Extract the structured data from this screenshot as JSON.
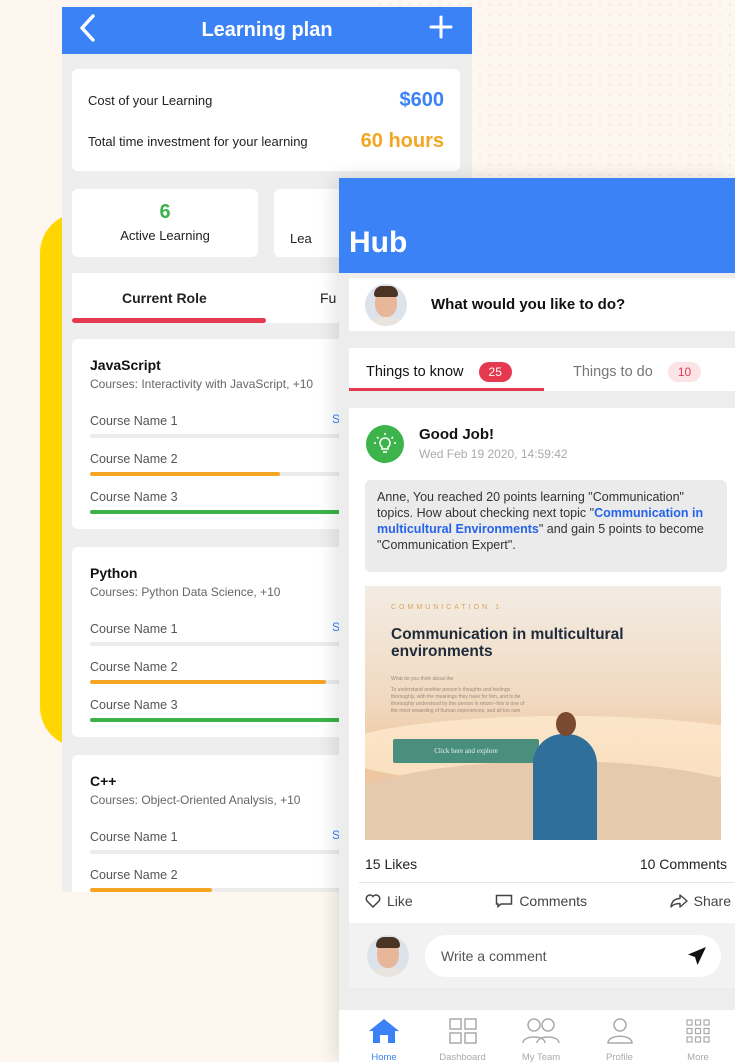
{
  "learning_plan": {
    "title": "Learning plan",
    "back_icon": "chevron-left-icon",
    "add_icon": "plus-icon",
    "cost_label": "Cost of your Learning",
    "cost_value": "$600",
    "time_label": "Total time investment for your learning",
    "time_value": "60 hours",
    "stats": [
      {
        "value": "6",
        "label": "Active Learning"
      },
      {
        "value": "",
        "label": "Lea"
      }
    ],
    "tabs": [
      {
        "label": "Current Role",
        "active": true
      },
      {
        "label": "Fu",
        "active": false
      }
    ],
    "courses": [
      {
        "name": "JavaScript",
        "subtitle": "Courses: Interactivity with JavaScript, +10",
        "rows": [
          {
            "label": "Course Name 1",
            "status": "S",
            "progress": 0,
            "color": "#e0e0e0"
          },
          {
            "label": "Course Name 2",
            "status": "",
            "progress": 0.5,
            "color": "#f4a623"
          },
          {
            "label": "Course Name 3",
            "status": "",
            "progress": 1.0,
            "color": "#3cb44b"
          }
        ]
      },
      {
        "name": "Python",
        "subtitle": "Courses: Python Data Science, +10",
        "rows": [
          {
            "label": "Course Name 1",
            "status": "S",
            "progress": 0,
            "color": "#e0e0e0"
          },
          {
            "label": "Course Name 2",
            "status": "",
            "progress": 0.62,
            "color": "#f4a623"
          },
          {
            "label": "Course Name 3",
            "status": "",
            "progress": 1.0,
            "color": "#3cb44b"
          }
        ]
      },
      {
        "name": "C++",
        "subtitle": "Courses: Object-Oriented Analysis, +10",
        "rows": [
          {
            "label": "Course Name 1",
            "status": "S",
            "progress": 0,
            "color": "#e0e0e0"
          },
          {
            "label": "Course Name 2",
            "status": "",
            "progress": 0.32,
            "color": "#f4a623"
          }
        ]
      }
    ]
  },
  "hub": {
    "title": "Hub",
    "ask_prompt": "What would you like to do?",
    "tabs": [
      {
        "label": "Things to know",
        "count": "25",
        "active": true
      },
      {
        "label": "Things to do",
        "count": "10",
        "active": false
      }
    ],
    "post": {
      "title": "Good Job!",
      "date": "Wed Feb 19 2020, 14:59:42",
      "message_before": "Anne, You reached 20 points learning \"Communication\" topics. How about checking next topic \"",
      "message_link": "Communication in multicultural Environments",
      "message_after": "\" and gain 5 points to become \"Communication Expert\".",
      "promo": {
        "ribbon": "COMMUNICATION 1",
        "headline": "Communication in multicultural environments",
        "small_heading": "What do you think about the",
        "small_text": "To understand another person's thoughts and feelings thoroughly, with the meanings they have for him, and to be thoroughly understood by this person in return--this is one of the most rewarding of human experiences, and all too rare",
        "cta": "Click here and explore"
      },
      "likes": "15 Likes",
      "comments": "10 Comments",
      "actions": {
        "like": "Like",
        "comments": "Comments",
        "share": "Share"
      }
    },
    "comment_placeholder": "Write a comment",
    "nav": [
      {
        "label": "Home",
        "icon": "home-icon",
        "active": true
      },
      {
        "label": "Dashboard",
        "icon": "dashboard-icon",
        "active": false
      },
      {
        "label": "My Team",
        "icon": "team-icon",
        "active": false
      },
      {
        "label": "Profile",
        "icon": "profile-icon",
        "active": false
      },
      {
        "label": "More",
        "icon": "more-grid-icon",
        "active": false
      }
    ]
  },
  "colors": {
    "primary": "#3b82f6",
    "green": "#3cb44b",
    "orange": "#f4a623",
    "red": "#e53950",
    "yellow": "#ffd600"
  }
}
